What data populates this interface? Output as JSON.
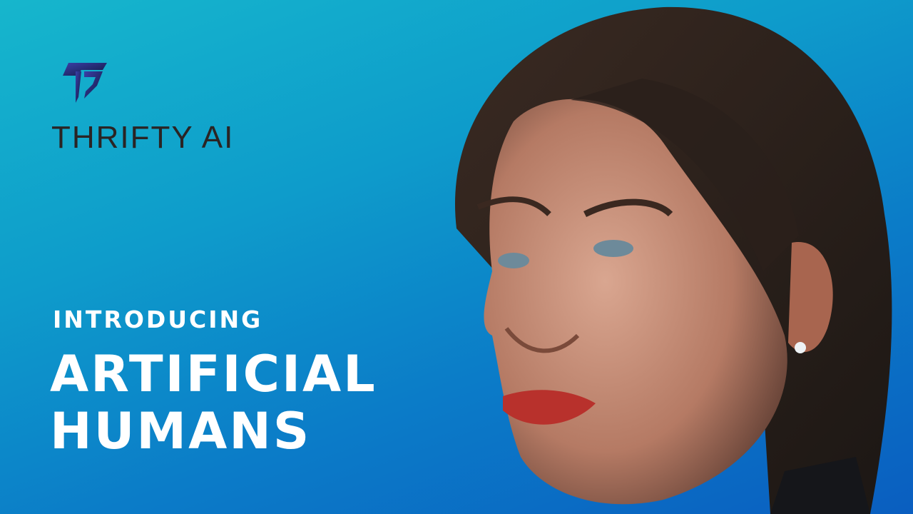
{
  "brand": {
    "name": "THRIFTY AI",
    "logo_icon": "thrifty-t-logo"
  },
  "hero": {
    "kicker": "INTRODUCING",
    "headline_line1": "ARTIFICIAL",
    "headline_line2": "HUMANS"
  },
  "colors": {
    "bg_top": "#16b6cc",
    "bg_bottom": "#0a5ec0",
    "text": "#ffffff",
    "brand_text": "#2a2424",
    "logo": "#1d2a7a"
  }
}
